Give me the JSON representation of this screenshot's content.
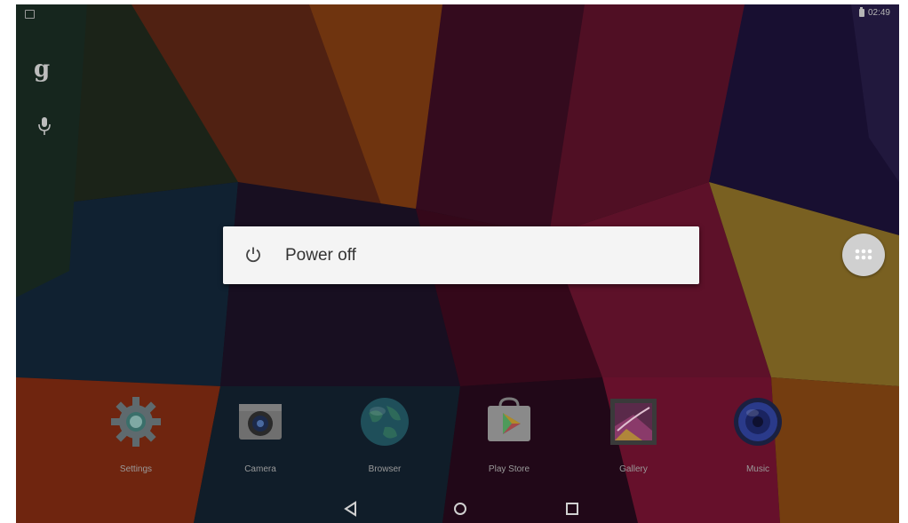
{
  "status_bar": {
    "time": "02:49",
    "left_icon": "screenshot-notification-icon",
    "battery_icon": "battery-icon"
  },
  "search_bar": {
    "google_glyph": "g",
    "mic_icon": "mic-icon"
  },
  "power_dialog": {
    "icon": "power-icon",
    "label": "Power off"
  },
  "all_apps": {
    "icon": "all-apps-grid-icon"
  },
  "dock": {
    "apps": [
      {
        "label": "Settings",
        "icon": "settings-gear-icon"
      },
      {
        "label": "Camera",
        "icon": "camera-icon"
      },
      {
        "label": "Browser",
        "icon": "globe-icon"
      },
      {
        "label": "Play Store",
        "icon": "play-store-icon"
      },
      {
        "label": "Gallery",
        "icon": "gallery-icon"
      },
      {
        "label": "Music",
        "icon": "speaker-icon"
      }
    ]
  },
  "nav_bar": {
    "back": "back-icon",
    "home": "home-icon",
    "recents": "recents-icon"
  },
  "colors": {
    "dialog_bg": "#f4f4f4",
    "dialog_text": "#333333",
    "status_text": "#b5b5b5"
  }
}
